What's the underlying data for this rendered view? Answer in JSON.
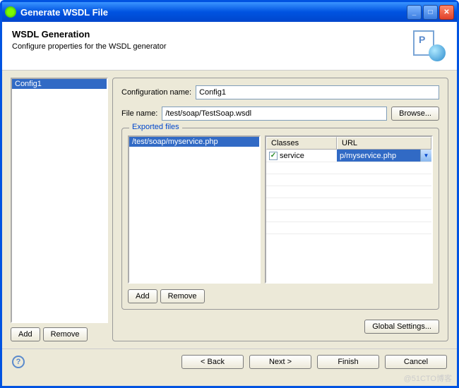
{
  "window": {
    "title": "Generate WSDL File"
  },
  "header": {
    "title": "WSDL Generation",
    "subtitle": "Configure properties for the WSDL generator"
  },
  "sidebar": {
    "configs": [
      "Config1"
    ],
    "add_label": "Add",
    "remove_label": "Remove"
  },
  "form": {
    "config_name_label": "Configuration name:",
    "config_name_value": "Config1",
    "file_name_label": "File name:",
    "file_name_value": "/test/soap/TestSoap.wsdl",
    "browse_label": "Browse..."
  },
  "exported": {
    "legend": "Exported files",
    "files": [
      "/test/soap/myservice.php"
    ],
    "add_label": "Add",
    "remove_label": "Remove",
    "table": {
      "headers": {
        "classes": "Classes",
        "url": "URL"
      },
      "rows": [
        {
          "checked": true,
          "class_name": "service",
          "url": "p/myservice.php"
        }
      ]
    }
  },
  "global_settings_label": "Global Settings...",
  "footer": {
    "back": "< Back",
    "next": "Next >",
    "finish": "Finish",
    "cancel": "Cancel"
  },
  "watermark": "@51CTO博客"
}
